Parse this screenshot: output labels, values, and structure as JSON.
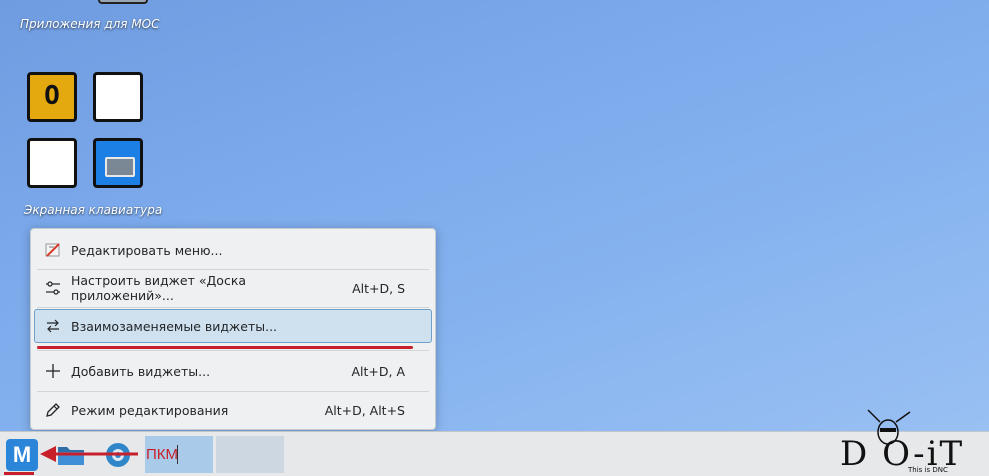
{
  "desktop": {
    "icon1_label": "Приложения для МОС",
    "icon2_label": "Экранная клавиатура",
    "key_o": "O"
  },
  "context_menu": {
    "items": [
      {
        "label": "Редактировать меню...",
        "shortcut": "",
        "icon": "edit-menu-icon"
      },
      {
        "label": "Настроить виджет «Доска приложений»...",
        "shortcut": "Alt+D, S",
        "icon": "configure-icon"
      },
      {
        "label": "Взаимозаменяемые виджеты...",
        "shortcut": "",
        "icon": "swap-widgets-icon"
      },
      {
        "label": "Добавить виджеты...",
        "shortcut": "Alt+D, A",
        "icon": "plus-icon"
      },
      {
        "label": "Режим редактирования",
        "shortcut": "Alt+D, Alt+S",
        "icon": "pencil-icon"
      }
    ]
  },
  "taskbar": {
    "launcher_letter": "M",
    "annotation": "ПКМ",
    "watermark_main": "D O-iT",
    "watermark_sub": "This is DNC"
  },
  "colors": {
    "accent": "#2b86d9",
    "highlight": "#cfe0ee",
    "annotation_red": "#c8202a"
  }
}
